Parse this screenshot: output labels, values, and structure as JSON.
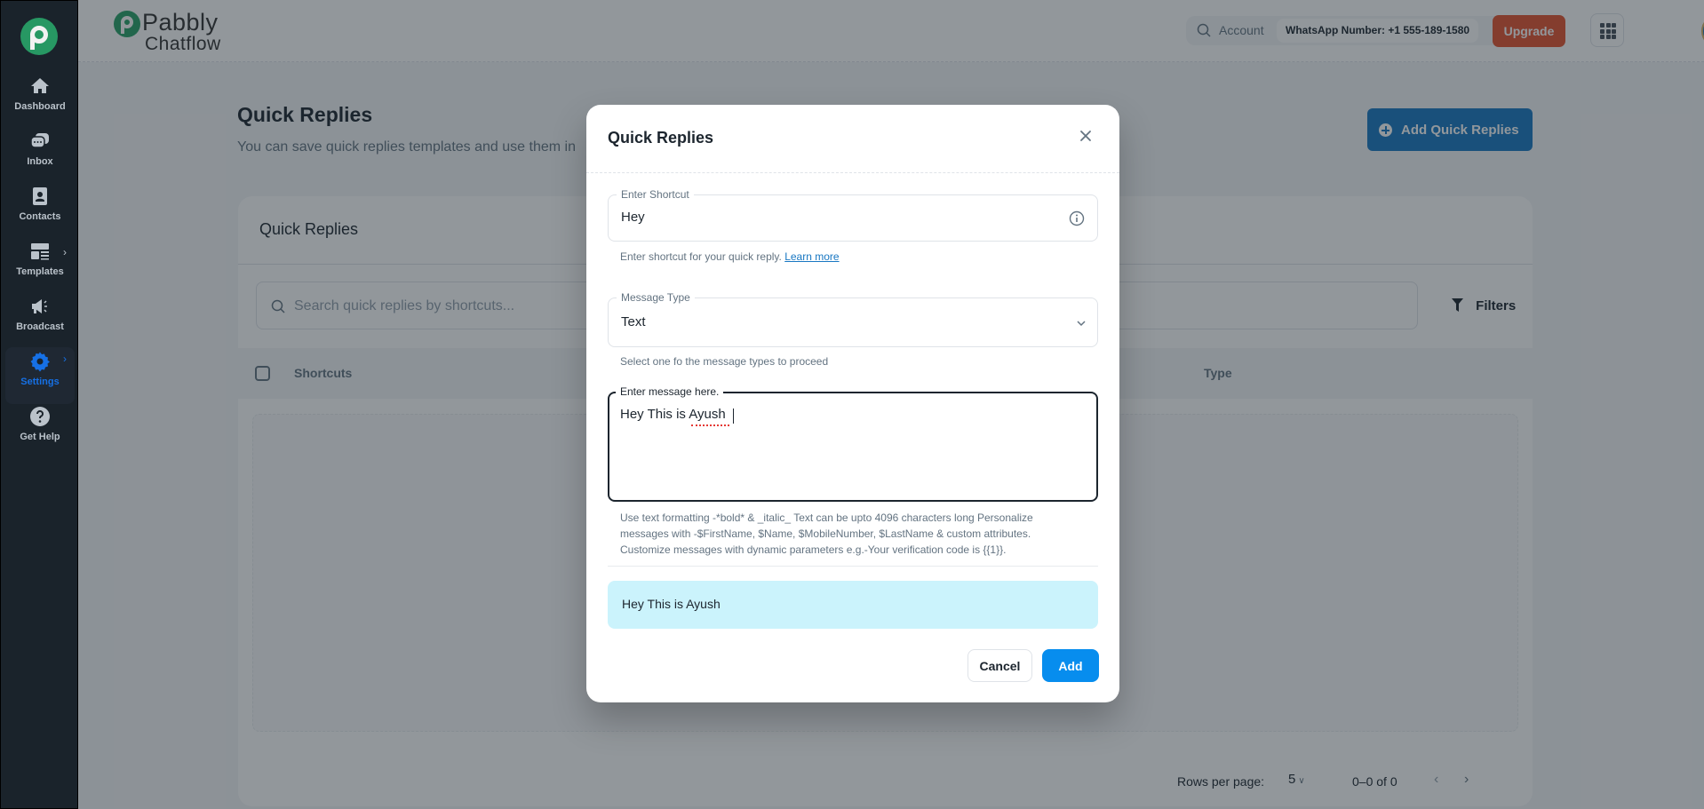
{
  "sidebar": {
    "items": [
      {
        "label": "Dashboard",
        "icon": "home-icon"
      },
      {
        "label": "Inbox",
        "icon": "chat-bubbles-icon"
      },
      {
        "label": "Contacts",
        "icon": "contact-book-icon"
      },
      {
        "label": "Templates",
        "icon": "layout-icon",
        "has_submenu": true
      },
      {
        "label": "Broadcast",
        "icon": "megaphone-icon"
      },
      {
        "label": "Settings",
        "icon": "gear-icon",
        "has_submenu": true,
        "active": true
      },
      {
        "label": "Get Help",
        "icon": "help-circle-icon"
      }
    ]
  },
  "header": {
    "brand_name": "Pabbly",
    "brand_sub": "Chatflow",
    "account_label": "Account",
    "whatsapp_number": "WhatsApp Number: +1 555-189-1580",
    "upgrade_label": "Upgrade"
  },
  "page": {
    "title": "Quick Replies",
    "subtitle": "You can save quick replies templates and use them in",
    "add_button": "Add Quick Replies"
  },
  "card": {
    "title": "Quick Replies",
    "search_placeholder": "Search quick replies by shortcuts...",
    "filters_label": "Filters",
    "columns": [
      "Shortcuts",
      "Type"
    ],
    "rows": [],
    "pagination": {
      "rows_per_page_label": "Rows per page:",
      "rows_per_page": "5",
      "range": "0–0 of 0"
    }
  },
  "modal": {
    "title": "Quick Replies",
    "shortcut": {
      "label": "Enter Shortcut",
      "value": "Hey",
      "helper": "Enter shortcut for your quick reply.",
      "learn_more": "Learn more"
    },
    "message_type": {
      "label": "Message Type",
      "value": "Text",
      "helper": "Select one fo the message types to proceed"
    },
    "message": {
      "label": "Enter message here.",
      "value": "Hey This is Ayush ",
      "helper": "Use text formatting -*bold* & _italic_ Text can be upto 4096 characters long Personalize messages with -$FirstName, $Name, $MobileNumber, $LastName & custom attributes. Customize messages with dynamic parameters e.g.-Your verification code is {{1}}."
    },
    "preview_text": "Hey This is Ayush",
    "cancel_label": "Cancel",
    "add_label": "Add"
  },
  "colors": {
    "sidebar_bg": "#1c252e",
    "accent_blue": "#1877c2",
    "add_button": "#078dee",
    "upgrade": "#e5532f",
    "brand_green": "#2aa169",
    "preview_bg": "#cbf3fc"
  }
}
